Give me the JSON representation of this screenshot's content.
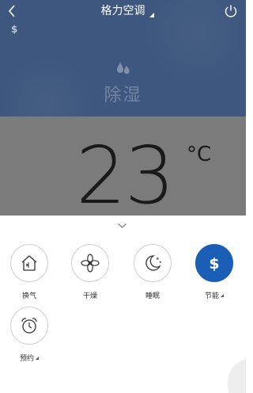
{
  "header": {
    "title": "格力空调"
  },
  "status": {
    "mode_label": "除湿",
    "energy_saving_indicator": "$"
  },
  "temperature": {
    "value": "23",
    "unit": "°C"
  },
  "functions": [
    {
      "label": "换气",
      "icon": "ventilation-icon",
      "active": false,
      "has_menu": false
    },
    {
      "label": "干燥",
      "icon": "fan-icon",
      "active": false,
      "has_menu": false
    },
    {
      "label": "睡眠",
      "icon": "moon-icon",
      "active": false,
      "has_menu": false
    },
    {
      "label": "节能",
      "icon": "dollar-icon",
      "active": true,
      "has_menu": true
    },
    {
      "label": "预约",
      "icon": "alarm-clock-icon",
      "active": false,
      "has_menu": true
    }
  ],
  "colors": {
    "header_bg": "#3e577e",
    "display_bg": "#7b7b7b",
    "active_button": "#1a5fb5"
  }
}
